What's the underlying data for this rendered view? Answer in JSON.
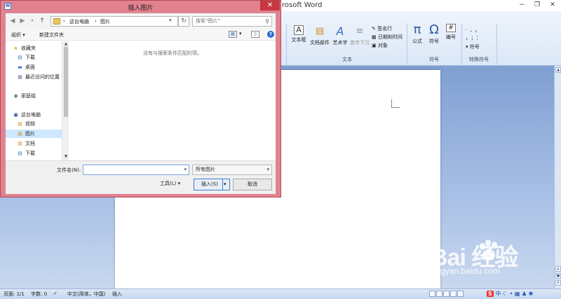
{
  "word": {
    "title": "rosoft Word",
    "window_buttons": [
      "−",
      "❐",
      "✕"
    ],
    "ribbon": {
      "text_group": {
        "label": "文本",
        "buttons": [
          "文本框",
          "文档部件",
          "艺术字",
          "首字下沉"
        ],
        "small_buttons": [
          "签名行",
          "日期和时间",
          "对象"
        ]
      },
      "symbols_group": {
        "label": "符号",
        "buttons": [
          "公式",
          "符号",
          "编号"
        ]
      },
      "special_group": {
        "label": "特殊符号",
        "button": "符号",
        "marks": [
          "·",
          "、",
          "。",
          "，",
          "；",
          "：",
          "？",
          "！"
        ]
      }
    }
  },
  "status": {
    "page": "页面: 1/1",
    "words": "字数: 0",
    "language": "中文(简体，中国)",
    "mode": "插入",
    "ime_label": "中"
  },
  "dialog": {
    "title": "插入图片",
    "app_icon": "W",
    "close_glyph": "✕",
    "breadcrumb": [
      "这台电脑",
      "图片"
    ],
    "search_placeholder": "搜索\"图片\"",
    "toolbar": {
      "organize": "组织 ▾",
      "new_folder": "新建文件夹"
    },
    "nav_items": [
      {
        "label": "收藏夹",
        "icon": "star-icon",
        "glyph": "★"
      },
      {
        "label": "下载",
        "icon": "download-folder-icon",
        "glyph": "▤"
      },
      {
        "label": "桌面",
        "icon": "desktop-icon",
        "glyph": "▬"
      },
      {
        "label": "最近访问的位置",
        "icon": "recent-places-icon",
        "glyph": "▦"
      },
      {
        "label": "家庭组",
        "icon": "homegroup-icon",
        "glyph": "◉"
      },
      {
        "label": "这台电脑",
        "icon": "computer-icon",
        "glyph": "▣"
      },
      {
        "label": "视频",
        "icon": "videos-folder-icon",
        "glyph": "▤"
      },
      {
        "label": "图片",
        "icon": "pictures-folder-icon",
        "glyph": "▤"
      },
      {
        "label": "文档",
        "icon": "documents-folder-icon",
        "glyph": "▤"
      },
      {
        "label": "下载",
        "icon": "download-folder-icon",
        "glyph": "▤"
      }
    ],
    "selected_nav": "图片",
    "empty_message": "没有与搜索条件匹配的项。",
    "filename_label": "文件名(N):",
    "filename_value": "",
    "filetype": "所有图片",
    "tools_label": "工具(L) ▾",
    "insert_label": "插入(S)",
    "cancel_label": "取消"
  },
  "watermark": {
    "brand": "Bai  经验",
    "url": "jingyan.baidu.com"
  },
  "colors": {
    "dialog_frame": "#e4818f",
    "close_button": "#c7373f",
    "word_blue": "#8fb0dc"
  }
}
